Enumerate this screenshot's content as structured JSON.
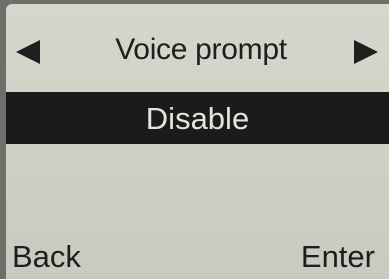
{
  "header": {
    "title": "Voice prompt",
    "prev_icon": "arrow-left-icon",
    "next_icon": "arrow-right-icon"
  },
  "options": {
    "selected": "Disable"
  },
  "softkeys": {
    "left": "Back",
    "right": "Enter"
  },
  "colors": {
    "screen_bg": "#d0d0c6",
    "highlight_bg": "#1b1b1b",
    "highlight_text": "#e4e4da",
    "text": "#1e1e1e"
  }
}
